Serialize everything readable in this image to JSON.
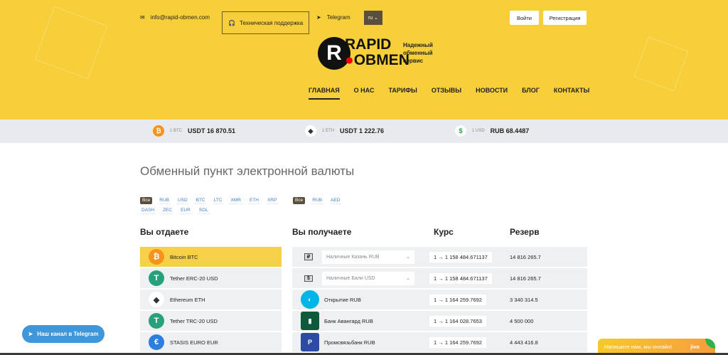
{
  "header": {
    "email": "info@rapid-obmen.com",
    "support": "Техническая поддержка",
    "telegram": "Telegram",
    "lang": "ru",
    "login": "Войти",
    "register": "Регистрация",
    "logo": {
      "line1": "RAPID",
      "line2": "OBMEN",
      "tagline1": "Надежный",
      "tagline2": "обменный",
      "tagline3": "сервис"
    },
    "nav": [
      "ГЛАВНАЯ",
      "О НАС",
      "ТАРИФЫ",
      "ОТЗЫВЫ",
      "НОВОСТИ",
      "БЛОГ",
      "КОНТАКТЫ"
    ]
  },
  "ticker": [
    {
      "unit": "1 BTC",
      "value": "USDT 16 870.51",
      "color": "#f7931a",
      "glyph": "₿"
    },
    {
      "unit": "1 ETH",
      "value": "USDT 1 222.76",
      "color": "#ffffff",
      "glyph": "◆"
    },
    {
      "unit": "1 USD",
      "value": "RUB 68.4487",
      "color": "#ffffff",
      "glyph": "$"
    }
  ],
  "title": "Обменный пункт электронной валюты",
  "filters_give": [
    "Все",
    "RUB",
    "USD",
    "BTC",
    "LTC",
    "XMR",
    "ETH",
    "XRP",
    "DASH",
    "ZEC",
    "EUR",
    "SOL"
  ],
  "filters_get": [
    "Все",
    "RUB",
    "AED"
  ],
  "columns": {
    "give": "Вы отдаете",
    "get": "Вы получаете",
    "rate": "Курс",
    "reserve": "Резерв"
  },
  "give": [
    {
      "name": "Bitcoin BTC",
      "color": "#f7931a",
      "glyph": "₿"
    },
    {
      "name": "Tether ERC-20 USD",
      "color": "#26a17b",
      "glyph": "T"
    },
    {
      "name": "Ethereum ETH",
      "color": "#ffffff",
      "glyph": "◆"
    },
    {
      "name": "Tether TRC-20 USD",
      "color": "#26a17b",
      "glyph": "T"
    },
    {
      "name": "STASIS EURO EUR",
      "color": "#2c7ee0",
      "glyph": "€"
    }
  ],
  "get": [
    {
      "name": "Наличные Казань RUB",
      "select": true,
      "glyph": "₽",
      "rate": "1 → 1 158 484.671137",
      "reserve": "14 816 265.7"
    },
    {
      "name": "Наличные Бали USD",
      "select": true,
      "glyph": "$",
      "rate": "1 → 1 158 484.671137",
      "reserve": "14 816 265.7"
    },
    {
      "name": "Открытие RUB",
      "select": false,
      "glyph": "◐",
      "color": "#00b4e6",
      "rate": "1 → 1 164 259.7692",
      "reserve": "3 340 314.5"
    },
    {
      "name": "Банк Авангард RUB",
      "select": false,
      "glyph": "▮",
      "color": "#0f5a3a",
      "rate": "1 → 1 164 028.7653",
      "reserve": "4 500 000"
    },
    {
      "name": "Промсвязьбанк RUB",
      "select": false,
      "glyph": "P",
      "color": "#2d4aa5",
      "rate": "1 → 1 164 259.7692",
      "reserve": "4 443 416.8"
    }
  ],
  "telegram_channel": "Наш канал в Telegram",
  "chat": {
    "text": "Напишите нам, мы онлайн!",
    "brand": "jivo"
  }
}
